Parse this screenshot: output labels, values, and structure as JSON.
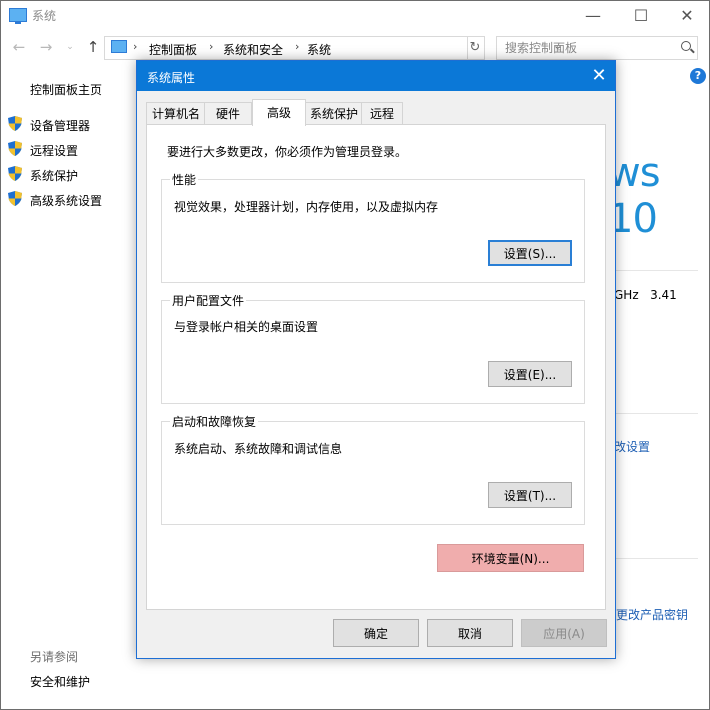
{
  "window": {
    "title": "系统",
    "breadcrumbs": [
      "控制面板",
      "系统和安全",
      "系统"
    ],
    "search_placeholder": "搜索控制面板"
  },
  "left_pane": {
    "home": "控制面板主页",
    "links": [
      "设备管理器",
      "远程设置",
      "系统保护",
      "高级系统设置"
    ],
    "see_also_heading": "另请参阅",
    "see_also_links": [
      "安全和维护"
    ]
  },
  "background": {
    "win10_fragment": "ws 10",
    "cpu_fragment": "GHz   3.41",
    "settings_link_fragment": "改设置",
    "product_key_fragment": "更改产品密钥",
    "help_glyph": "?"
  },
  "dialog": {
    "title": "系统属性",
    "tabs": [
      "计算机名",
      "硬件",
      "高级",
      "系统保护",
      "远程"
    ],
    "active_tab": "高级",
    "admin_note": "要进行大多数更改，你必须作为管理员登录。",
    "groups": {
      "performance": {
        "title": "性能",
        "description": "视觉效果，处理器计划，内存使用，以及虚拟内存",
        "button": "设置(S)..."
      },
      "user_profiles": {
        "title": "用户配置文件",
        "description": "与登录帐户相关的桌面设置",
        "button": "设置(E)..."
      },
      "startup_recovery": {
        "title": "启动和故障恢复",
        "description": "系统启动、系统故障和调试信息",
        "button": "设置(T)..."
      }
    },
    "env_button": "环境变量(N)...",
    "footer": {
      "ok": "确定",
      "cancel": "取消",
      "apply": "应用(A)"
    }
  },
  "colors": {
    "dialog_titlebar": "#0b78d7",
    "env_button_highlight": "#f0adad",
    "link_blue": "#1e5fb4"
  }
}
